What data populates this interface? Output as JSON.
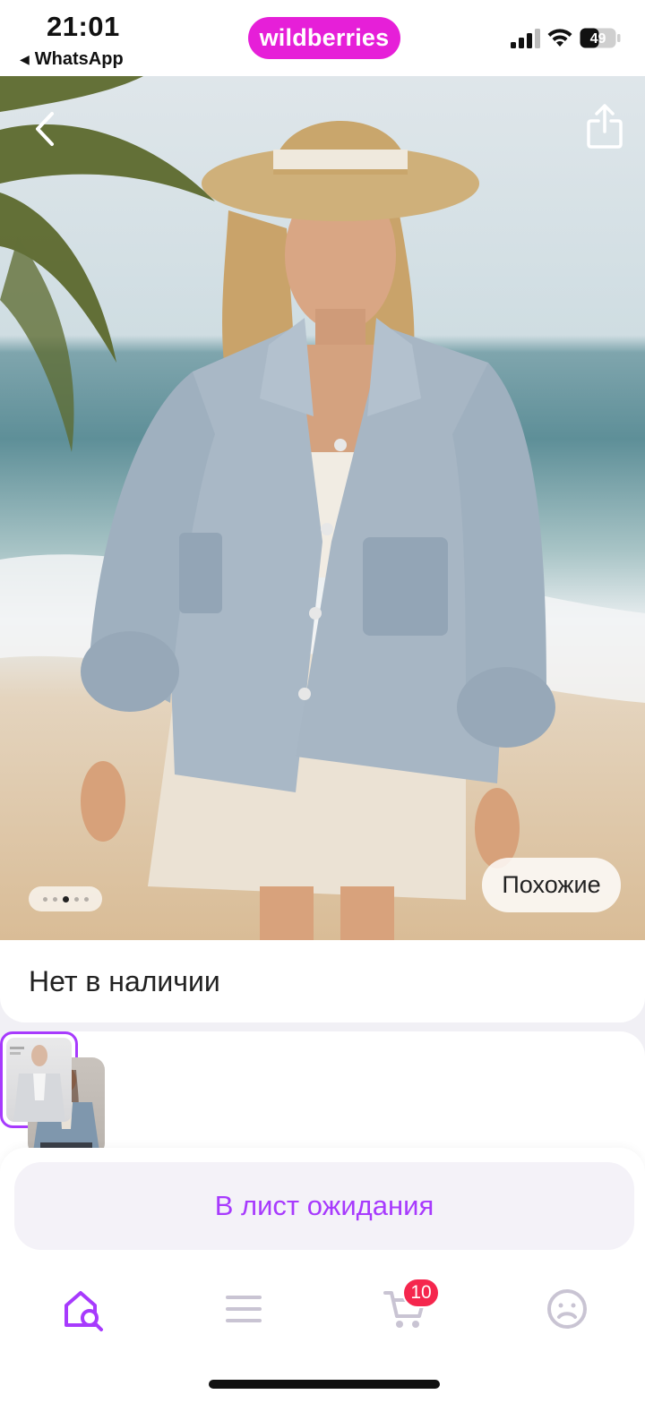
{
  "status_bar": {
    "time": "21:01",
    "back_app": "WhatsApp",
    "battery": "49",
    "icons": [
      "signal-icon",
      "wifi-icon",
      "battery-icon"
    ]
  },
  "header": {
    "logo": "wildberries"
  },
  "gallery": {
    "photo": "product-photo-woman-denim-jacket",
    "page_count": 5,
    "active_page": 3,
    "similar_label": "Похожие",
    "icons": [
      "back-icon",
      "share-icon"
    ]
  },
  "availability": {
    "text": "Нет в наличии"
  },
  "variants": {
    "selected_index": 1,
    "items": [
      "variant-thumb-1",
      "variant-thumb-2"
    ]
  },
  "action": {
    "waitlist_label": "В лист ожидания"
  },
  "tabbar": {
    "cart_count": "10",
    "icons": [
      "home-search-icon",
      "catalog-icon",
      "cart-icon",
      "profile-icon"
    ]
  },
  "colors": {
    "brand": "#e61fd8",
    "accent": "#a73afd",
    "badge": "#f5264d"
  }
}
